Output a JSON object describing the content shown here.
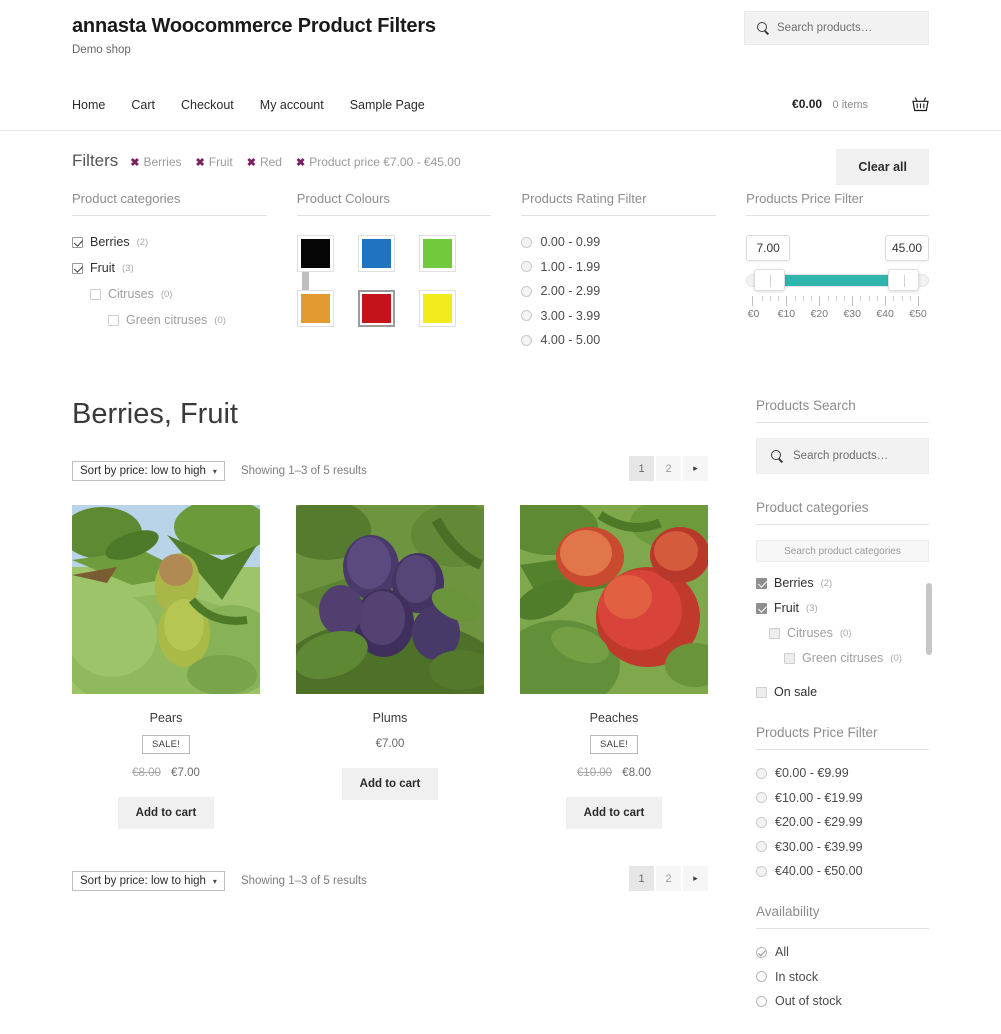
{
  "header": {
    "brand_title": "annasta Woocommerce Product Filters",
    "brand_tagline": "Demo shop",
    "search_placeholder": "Search products…",
    "search_icon": "search-icon",
    "nav": [
      {
        "label": "Home"
      },
      {
        "label": "Cart"
      },
      {
        "label": "Checkout"
      },
      {
        "label": "My account"
      },
      {
        "label": "Sample Page"
      }
    ],
    "cart": {
      "total": "€0.00",
      "items": "0 items",
      "icon": "shopping-basket-icon"
    }
  },
  "filter_bar": {
    "label": "Filters",
    "clear_all": "Clear all",
    "chips": [
      {
        "x": "✖",
        "label": "Berries"
      },
      {
        "x": "✖",
        "label": "Fruit"
      },
      {
        "x": "✖",
        "label": "Red"
      },
      {
        "x": "✖",
        "label": "Product price €7.00 - €45.00"
      }
    ],
    "categories_panel": {
      "title": "Product categories",
      "items": [
        {
          "label": "Berries",
          "count": "(2)",
          "level": 0,
          "checked": true
        },
        {
          "label": "Fruit",
          "count": "(3)",
          "level": 0,
          "checked": true
        },
        {
          "label": "Citruses",
          "count": "(0)",
          "level": 1,
          "checked": false
        },
        {
          "label": "Green citruses",
          "count": "(0)",
          "level": 2,
          "checked": false
        }
      ]
    },
    "colours_panel": {
      "title": "Product Colours",
      "swatches": [
        {
          "name": "black",
          "hex": "#050505",
          "selected": false
        },
        {
          "name": "blue",
          "hex": "#1f73bf",
          "selected": false
        },
        {
          "name": "green",
          "hex": "#73c93c",
          "selected": false
        },
        {
          "name": "orange",
          "hex": "#e39a30",
          "selected": false
        },
        {
          "name": "red",
          "hex": "#c4131a",
          "selected": true
        },
        {
          "name": "yellow",
          "hex": "#f2ec1d",
          "selected": false
        }
      ]
    },
    "rating_panel": {
      "title": "Products Rating Filter",
      "options": [
        {
          "label": "0.00 - 0.99",
          "selected": false
        },
        {
          "label": "1.00 - 1.99",
          "selected": false
        },
        {
          "label": "2.00 - 2.99",
          "selected": false
        },
        {
          "label": "3.00 - 3.99",
          "selected": false
        },
        {
          "label": "4.00 - 5.00",
          "selected": false
        }
      ]
    },
    "price_panel": {
      "title": "Products Price Filter",
      "min_value": "7.00",
      "max_value": "45.00",
      "fill_color": "#2fb5ac",
      "tick_labels": [
        "€0",
        "€10",
        "€20",
        "€30",
        "€40",
        "€50"
      ]
    }
  },
  "main": {
    "shop_title": "Berries, Fruit",
    "sort_value": "Sort by price: low to high",
    "sort_caret": "▾",
    "result_count": "Showing 1–3 of 5 results",
    "pagination": [
      {
        "label": "1",
        "active": true
      },
      {
        "label": "2",
        "active": false
      },
      {
        "label": "▸",
        "active": false,
        "next": true
      }
    ],
    "products": [
      {
        "name": "Pears",
        "image": "pears-on-tree",
        "sale": "SALE!",
        "price_old": "€8.00",
        "price": "€7.00",
        "add_to_cart": "Add to cart"
      },
      {
        "name": "Plums",
        "image": "plums-on-tree",
        "sale": "",
        "price_old": "",
        "price": "€7.00",
        "add_to_cart": "Add to cart"
      },
      {
        "name": "Peaches",
        "image": "peaches-on-tree",
        "sale": "SALE!",
        "price_old": "€10.00",
        "price": "€8.00",
        "add_to_cart": "Add to cart"
      }
    ]
  },
  "sidebar": {
    "search_widget": {
      "title": "Products Search",
      "placeholder": "Search products…",
      "icon": "search-icon"
    },
    "categories_widget": {
      "title": "Product categories",
      "search_placeholder": "Search product categories",
      "items": [
        {
          "label": "Berries",
          "count": "(2)",
          "level": 0,
          "checked": true
        },
        {
          "label": "Fruit",
          "count": "(3)",
          "level": 0,
          "checked": true
        },
        {
          "label": "Citruses",
          "count": "(0)",
          "level": 1,
          "checked": false
        },
        {
          "label": "Green citruses",
          "count": "(0)",
          "level": 2,
          "checked": false
        }
      ],
      "on_sale_label": "On sale",
      "on_sale_checked": false
    },
    "price_widget": {
      "title": "Products Price Filter",
      "options": [
        {
          "label": "€0.00 - €9.99",
          "selected": false
        },
        {
          "label": "€10.00 - €19.99",
          "selected": false
        },
        {
          "label": "€20.00 - €29.99",
          "selected": false
        },
        {
          "label": "€30.00 - €39.99",
          "selected": false
        },
        {
          "label": "€40.00 - €50.00",
          "selected": false
        }
      ]
    },
    "availability_widget": {
      "title": "Availability",
      "options": [
        {
          "label": "All",
          "selected": true
        },
        {
          "label": "In stock",
          "selected": false
        },
        {
          "label": "Out of stock",
          "selected": false
        }
      ]
    }
  }
}
